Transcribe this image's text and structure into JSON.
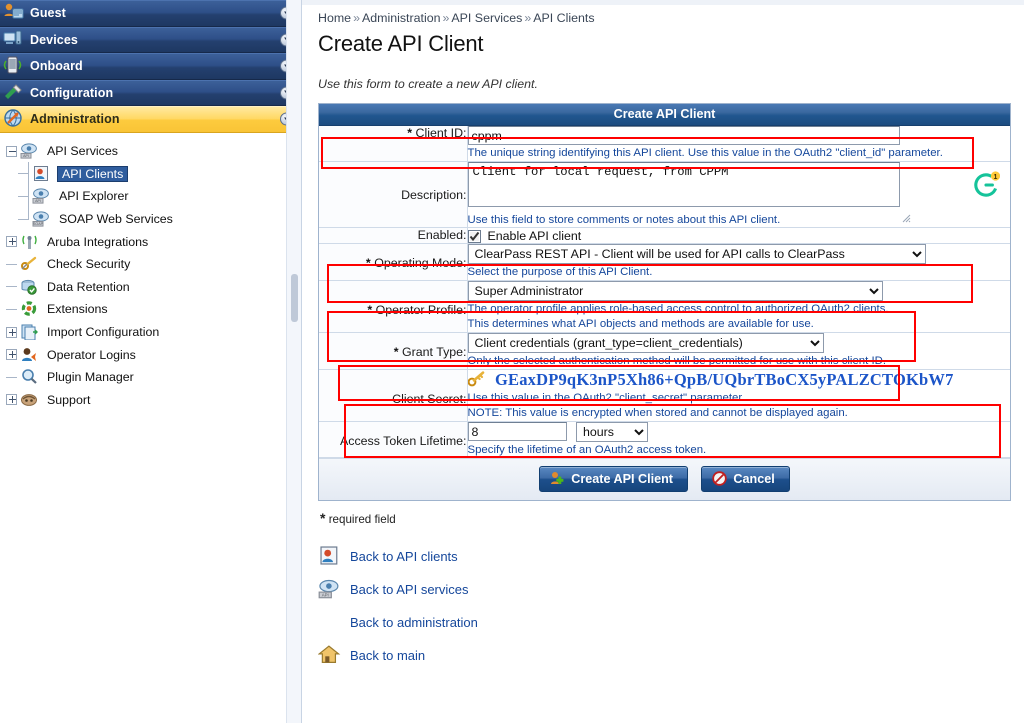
{
  "sidebar": {
    "groups": [
      {
        "label": "Guest",
        "icon": "guest-users-icon",
        "active": false
      },
      {
        "label": "Devices",
        "icon": "devices-icon",
        "active": false
      },
      {
        "label": "Onboard",
        "icon": "onboard-mobile-icon",
        "active": false
      },
      {
        "label": "Configuration",
        "icon": "configuration-wrench-icon",
        "active": false
      },
      {
        "label": "Administration",
        "icon": "administration-globe-icon",
        "active": true
      }
    ],
    "tree": [
      {
        "label": "API Services",
        "level": 1,
        "toggle": "minus",
        "icon": "api-services-icon",
        "selected": false
      },
      {
        "label": "API Clients",
        "level": 2,
        "toggle": "none",
        "icon": "api-clients-icon",
        "selected": true
      },
      {
        "label": "API Explorer",
        "level": 2,
        "toggle": "none",
        "icon": "api-explorer-icon",
        "selected": false
      },
      {
        "label": "SOAP Web Services",
        "level": 2,
        "toggle": "none",
        "icon": "soap-web-services-icon",
        "selected": false
      },
      {
        "label": "Aruba Integrations",
        "level": 1,
        "toggle": "plus",
        "icon": "aruba-integrations-icon",
        "selected": false
      },
      {
        "label": "Check Security",
        "level": 1,
        "toggle": "none",
        "icon": "check-security-key-icon",
        "selected": false
      },
      {
        "label": "Data Retention",
        "level": 1,
        "toggle": "none",
        "icon": "data-retention-icon",
        "selected": false
      },
      {
        "label": "Extensions",
        "level": 1,
        "toggle": "none",
        "icon": "extensions-icon",
        "selected": false
      },
      {
        "label": "Import Configuration",
        "level": 1,
        "toggle": "plus",
        "icon": "import-configuration-icon",
        "selected": false
      },
      {
        "label": "Operator Logins",
        "level": 1,
        "toggle": "plus",
        "icon": "operator-logins-icon",
        "selected": false
      },
      {
        "label": "Plugin Manager",
        "level": 1,
        "toggle": "none",
        "icon": "plugin-manager-magnifier-icon",
        "selected": false
      },
      {
        "label": "Support",
        "level": 1,
        "toggle": "plus",
        "icon": "support-icon",
        "selected": false
      }
    ]
  },
  "breadcrumb": {
    "items": [
      "Home",
      "Administration",
      "API Services",
      "API Clients"
    ],
    "separator": "»"
  },
  "page": {
    "title": "Create API Client",
    "intro": "Use this form to create a new API client."
  },
  "form": {
    "header": "Create API Client",
    "client_id": {
      "label": "Client ID:",
      "required_mark": "*",
      "value": "cppm",
      "hint": "The unique string identifying this API client. Use this value in the OAuth2 \"client_id\" parameter."
    },
    "description": {
      "label": "Description:",
      "value": "Client for local request, from CPPM",
      "hint": "Use this field to store comments or notes about this API client.",
      "grammarly_badge": "1"
    },
    "enabled": {
      "label": "Enabled:",
      "checkbox_label": "Enable API client",
      "checked": true
    },
    "operating_mode": {
      "label": "Operating Mode:",
      "required_mark": "*",
      "value": "ClearPass REST API - Client will be used for API calls to ClearPass",
      "hint": "Select the purpose of this API Client."
    },
    "operator_profile": {
      "label": "Operator Profile:",
      "required_mark": "*",
      "value": "Super Administrator",
      "hint1": "The operator profile applies role-based access control to authorized OAuth2 clients.",
      "hint2": "This determines what API objects and methods are available for use."
    },
    "grant_type": {
      "label": "Grant Type:",
      "required_mark": "*",
      "value": "Client credentials (grant_type=client_credentials)",
      "hint": "Only the selected authentication method will be permitted for use with this client ID."
    },
    "client_secret": {
      "label": "Client Secret:",
      "value": "GEaxDP9qK3nP5Xh86+QpB/UQbrTBoCX5yPALZCTOKbW7",
      "hint": "Use this value in the OAuth2 \"client_secret\" parameter.",
      "note": "NOTE: This value is encrypted when stored and cannot be displayed again."
    },
    "access_token_lifetime": {
      "label": "Access Token Lifetime:",
      "value": "8",
      "unit": "hours",
      "hint": "Specify the lifetime of an OAuth2 access token."
    },
    "buttons": {
      "submit": "Create API Client",
      "cancel": "Cancel"
    }
  },
  "required_field_note": "required field",
  "required_field_star": "*",
  "back_links": [
    {
      "label": "Back to API clients",
      "icon": "api-clients-icon"
    },
    {
      "label": "Back to API services",
      "icon": "api-services-icon"
    },
    {
      "label": "Back to administration",
      "icon": "administration-globe-icon"
    },
    {
      "label": "Back to main",
      "icon": "home-icon"
    }
  ],
  "colors": {
    "nav_blue": "#2e4f88",
    "nav_active_yellow": "#ffd862",
    "panel_header_blue": "#21568f",
    "hint_blue": "#15479b",
    "annotation_red": "#ff0000",
    "secret_blue": "#1c55c8"
  }
}
